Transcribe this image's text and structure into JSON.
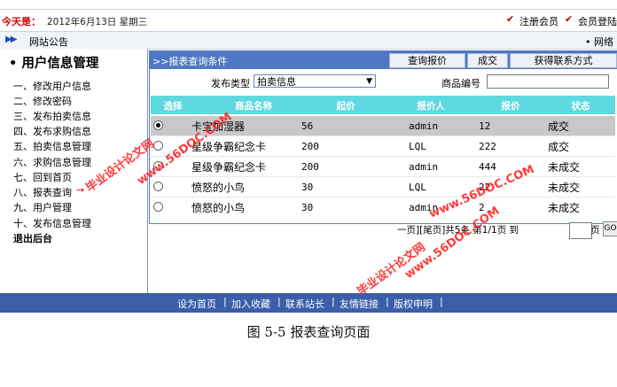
{
  "datebar": {
    "today_label": "今天是：",
    "date": "2012年6月13日 星期三",
    "register_label": "注册会员",
    "login_label": "会员登陆"
  },
  "notice": {
    "label": "网站公告",
    "right_text": "• 网络"
  },
  "sidebar": {
    "title": "• 用户信息管理",
    "items": [
      {
        "label": "一、修改用户信息"
      },
      {
        "label": "二、修改密码"
      },
      {
        "label": "三、发布拍卖信息"
      },
      {
        "label": "四、发布求购信息"
      },
      {
        "label": "五、拍卖信息管理"
      },
      {
        "label": "六、求购信息管理"
      },
      {
        "label": "七、回到首页"
      },
      {
        "label": "八、报表查询"
      },
      {
        "label": "九、用户管理"
      },
      {
        "label": "十、发布信息管理"
      },
      {
        "label": "退出后台"
      }
    ],
    "active_arrow": "→"
  },
  "panel": {
    "crumb": ">>报表查询条件",
    "tabs": [
      "查询报价",
      "成交",
      "获得联系方式"
    ]
  },
  "filters": {
    "type_label": "发布类型",
    "type_value": "拍卖信息",
    "product_label": "商品编号",
    "product_value": ""
  },
  "table": {
    "headers": [
      "选择",
      "商品名称",
      "起价",
      "报价人",
      "报价",
      "状态"
    ],
    "rows": [
      {
        "selected": true,
        "name": "卡宝加湿器",
        "start": "56",
        "bidder": "admin",
        "bid": "12",
        "status": "成交"
      },
      {
        "selected": false,
        "name": "星级争霸纪念卡",
        "start": "200",
        "bidder": "LQL",
        "bid": "222",
        "status": "成交"
      },
      {
        "selected": false,
        "name": "星级争霸纪念卡",
        "start": "200",
        "bidder": "admin",
        "bid": "444",
        "status": "未成交"
      },
      {
        "selected": false,
        "name": "愤怒的小鸟",
        "start": "30",
        "bidder": "LQL",
        "bid": "22",
        "status": "未成交"
      },
      {
        "selected": false,
        "name": "愤怒的小鸟",
        "start": "30",
        "bidder": "admin",
        "bid": "2",
        "status": "未成交"
      }
    ]
  },
  "pager": {
    "text": "一页][尾页]共5条 第1/1页 到",
    "page_unit": "页",
    "go_label": "GO"
  },
  "footer": {
    "links": [
      "设为首页",
      "加入收藏",
      "联系站长",
      "友情链接",
      "版权申明"
    ]
  },
  "caption": "图 5-5 报表查询页面",
  "watermark": {
    "line1": "毕业设计论文网",
    "line2": "www.56DOC.COM"
  },
  "colors": {
    "header_blue": "#4f78c2",
    "table_header_cyan": "#5fd9e0",
    "footer_blue": "#3a5ea8",
    "watermark_red": "#ff2626"
  }
}
